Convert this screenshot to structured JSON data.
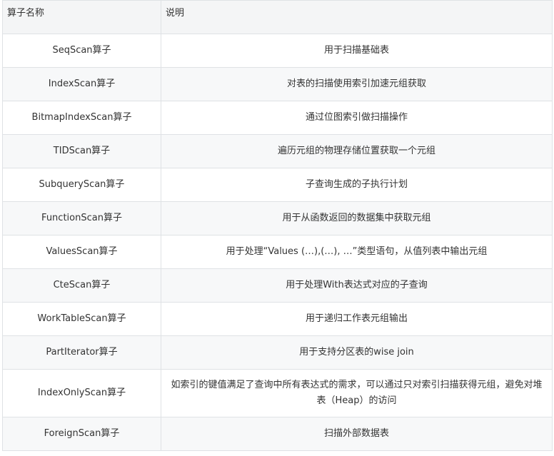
{
  "table": {
    "headers": [
      "算子名称",
      "说明"
    ],
    "rows": [
      {
        "name": "SeqScan算子",
        "desc": "用于扫描基础表"
      },
      {
        "name": "IndexScan算子",
        "desc": "对表的扫描使用索引加速元组获取"
      },
      {
        "name": "BitmapIndexScan算子",
        "desc": "通过位图索引做扫描操作"
      },
      {
        "name": "TIDScan算子",
        "desc": "遍历元组的物理存储位置获取一个元组"
      },
      {
        "name": "SubqueryScan算子",
        "desc": "子查询生成的子执行计划"
      },
      {
        "name": "FunctionScan算子",
        "desc": "用于从函数返回的数据集中获取元组"
      },
      {
        "name": "ValuesScan算子",
        "desc": "用于处理“Values (…),(…), …”类型语句，从值列表中输出元组"
      },
      {
        "name": "CteScan算子",
        "desc": "用于处理With表达式对应的子查询"
      },
      {
        "name": "WorkTableScan算子",
        "desc": "用于递归工作表元组输出"
      },
      {
        "name": "PartIterator算子",
        "desc": "用于支持分区表的wise join"
      },
      {
        "name": "IndexOnlyScan算子",
        "desc": "如索引的键值满足了查询中所有表达式的需求，可以通过只对索引扫描获得元组，避免对堆表（Heap）的访问"
      },
      {
        "name": "ForeignScan算子",
        "desc": "扫描外部数据表"
      }
    ]
  }
}
